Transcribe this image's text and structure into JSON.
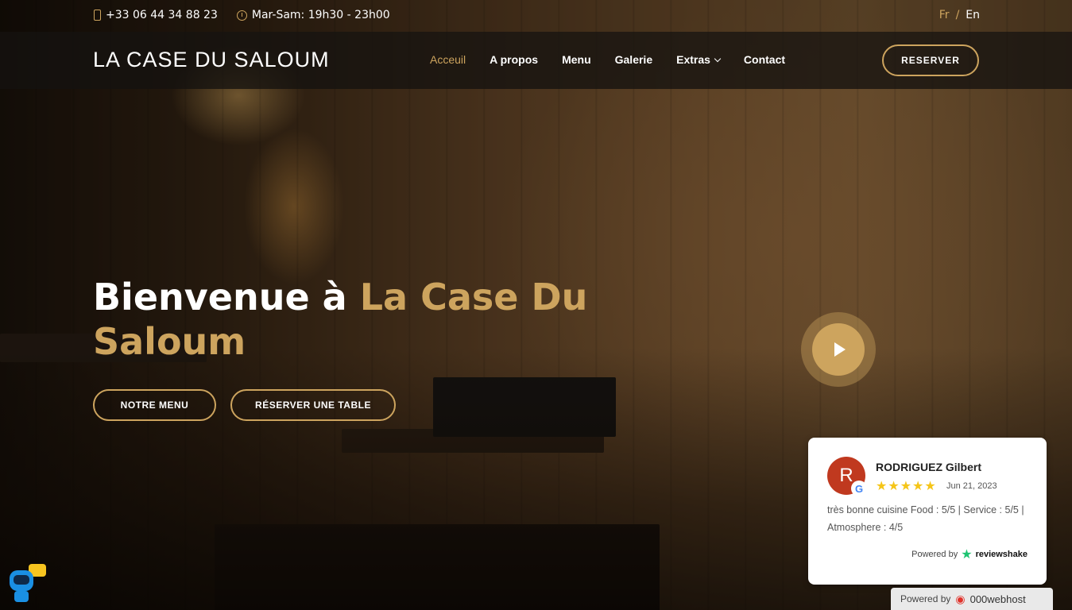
{
  "topbar": {
    "phone": "+33 06 44 34 88 23",
    "hours": "Mar-Sam: 19h30 - 23h00",
    "lang_fr": "Fr",
    "lang_sep": "/",
    "lang_en": "En"
  },
  "header": {
    "logo": "LA CASE DU SALOUM",
    "nav": [
      "Acceuil",
      "A propos",
      "Menu",
      "Galerie",
      "Extras",
      "Contact"
    ],
    "reserve_label": "RESERVER"
  },
  "hero": {
    "title_white": "Bienvenue à ",
    "title_accent": "La Case Du Saloum",
    "btn_menu": "NOTRE MENU",
    "btn_table": "RÉSERVER UNE TABLE"
  },
  "review": {
    "avatar_letter": "R",
    "google_letter": "G",
    "name": "RODRIGUEZ Gilbert",
    "stars": "★★★★★",
    "rating": 5,
    "date": "Jun 21, 2023",
    "text": "très bonne cuisine Food : 5/5 | Service : 5/5 | Atmosphere : 4/5",
    "powered_by": "Powered by",
    "brand": "reviewshake"
  },
  "footer_badge": {
    "powered_by": "Powered by",
    "brand": "000webhost"
  },
  "colors": {
    "accent": "#cda45e",
    "avatar": "#c0391f",
    "stars": "#f5c518"
  },
  "icons": [
    "phone-icon",
    "clock-icon",
    "chevron-down-icon",
    "play-icon",
    "google-icon",
    "reviewshake-icon",
    "webhost-icon",
    "chatbot-icon"
  ]
}
